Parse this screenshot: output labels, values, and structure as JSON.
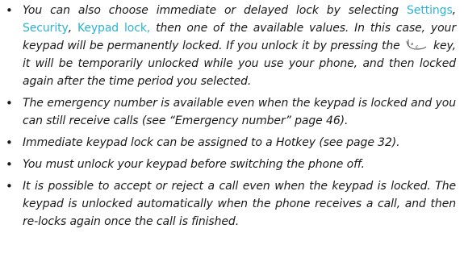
{
  "bullet_char": "•",
  "link_color": "#2bb3d6",
  "items": [
    {
      "parts": {
        "t1": "You can also choose immediate or delayed lock by selecting ",
        "l1": "Settings",
        "s1": ", ",
        "l2": "Security",
        "s2": ", ",
        "l3": "Keypad lock,",
        "t2": " then one of the available values. In this case, your keypad will be permanently locked. If you unlock it by pressing the ",
        "key_icon": "clear-key-icon",
        "t3": " key, it will be temporarily unlocked while you use your phone, and then locked again after the time period you selected."
      }
    },
    {
      "text": "The emergency number is available even when the keypad is locked and you can still receive calls (see “Emergency number” page 46)."
    },
    {
      "text": "Immediate keypad lock can be assigned to a Hotkey (see page 32)."
    },
    {
      "text": "You must unlock your keypad before switching the phone off."
    },
    {
      "text": "It is possible to accept or reject a call even when the keypad is locked. The keypad is unlocked automatically when the phone receives a call, and then re-locks again once the call is finished."
    }
  ]
}
